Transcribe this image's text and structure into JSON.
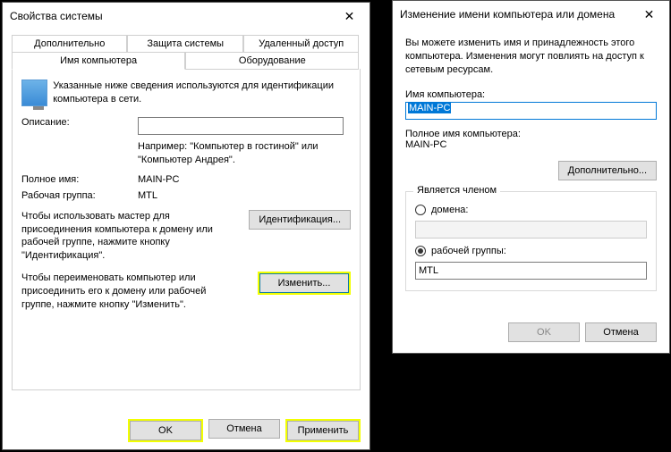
{
  "dialog1": {
    "title": "Свойства системы",
    "tabs": {
      "advanced": "Дополнительно",
      "protection": "Защита системы",
      "remote": "Удаленный доступ",
      "name": "Имя компьютера",
      "hardware": "Оборудование"
    },
    "intro": "Указанные ниже сведения используются для идентификации компьютера в сети.",
    "desc_label": "Описание:",
    "desc_value": "",
    "desc_hint": "Например: \"Компьютер в гостиной\" или \"Компьютер Андрея\".",
    "fullname_label": "Полное имя:",
    "fullname_value": "MAIN-PC",
    "workgroup_label": "Рабочая группа:",
    "workgroup_value": "MTL",
    "wizard_text": "Чтобы использовать мастер для присоединения компьютера к домену или рабочей группе, нажмите кнопку \"Идентификация\".",
    "wizard_btn": "Идентификация...",
    "rename_text": "Чтобы переименовать компьютер или присоединить его к домену или рабочей группе, нажмите кнопку \"Изменить\".",
    "rename_btn": "Изменить...",
    "ok": "OK",
    "cancel": "Отмена",
    "apply": "Применить"
  },
  "dialog2": {
    "title": "Изменение имени компьютера или домена",
    "info": "Вы можете изменить имя и принадлежность этого компьютера. Изменения могут повлиять на доступ к сетевым ресурсам.",
    "pcname_label": "Имя компьютера:",
    "pcname_value": "MAIN-PC",
    "fullpc_label": "Полное имя компьютера:",
    "fullpc_value": "MAIN-PC",
    "more_btn": "Дополнительно...",
    "member_title": "Является членом",
    "domain_label": "домена:",
    "domain_value": "",
    "workgroup_label": "рабочей группы:",
    "workgroup_value": "MTL",
    "ok": "OK",
    "cancel": "Отмена"
  }
}
